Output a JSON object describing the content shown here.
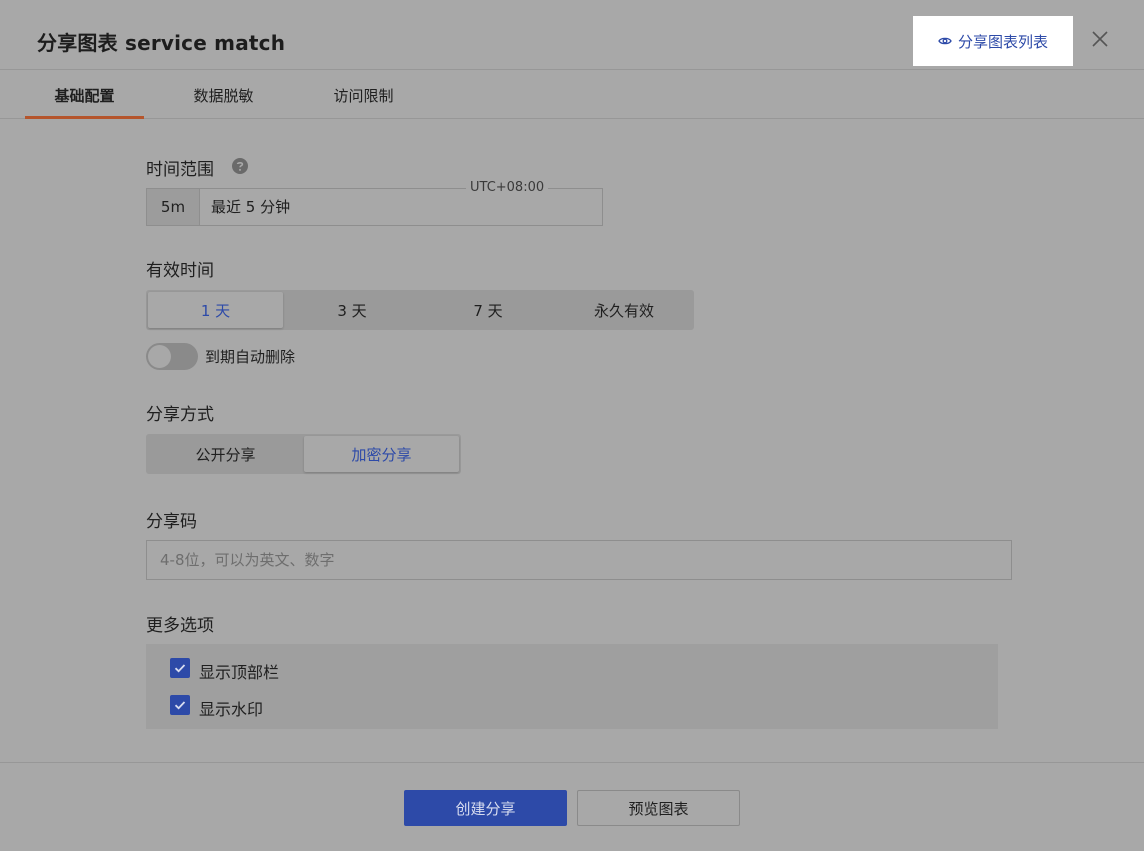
{
  "dialog": {
    "title": "分享图表 service match",
    "share_list_link": "分享图表列表"
  },
  "tabs": [
    {
      "label": "基础配置",
      "active": true
    },
    {
      "label": "数据脱敏",
      "active": false
    },
    {
      "label": "访问限制",
      "active": false
    }
  ],
  "time_range": {
    "label": "时间范围",
    "quick_value": "5m",
    "value": "最近 5 分钟",
    "timezone": "UTC+08:00"
  },
  "validity": {
    "label": "有效时间",
    "options": [
      "1 天",
      "3 天",
      "7 天",
      "永久有效"
    ],
    "selected": "1 天",
    "auto_delete_label": "到期自动删除",
    "auto_delete_enabled": false
  },
  "share_mode": {
    "label": "分享方式",
    "options": [
      "公开分享",
      "加密分享"
    ],
    "selected": "加密分享"
  },
  "share_code": {
    "label": "分享码",
    "placeholder": "4-8位，可以为英文、数字",
    "value": ""
  },
  "more_options": {
    "label": "更多选项",
    "items": [
      {
        "label": "显示顶部栏",
        "checked": true
      },
      {
        "label": "显示水印",
        "checked": true
      }
    ]
  },
  "footer": {
    "create_label": "创建分享",
    "preview_label": "预览图表"
  },
  "colors": {
    "accent": "#2d4aa8",
    "tab_underline": "#b5552c",
    "overlay_bg": "#a8a8a8"
  }
}
